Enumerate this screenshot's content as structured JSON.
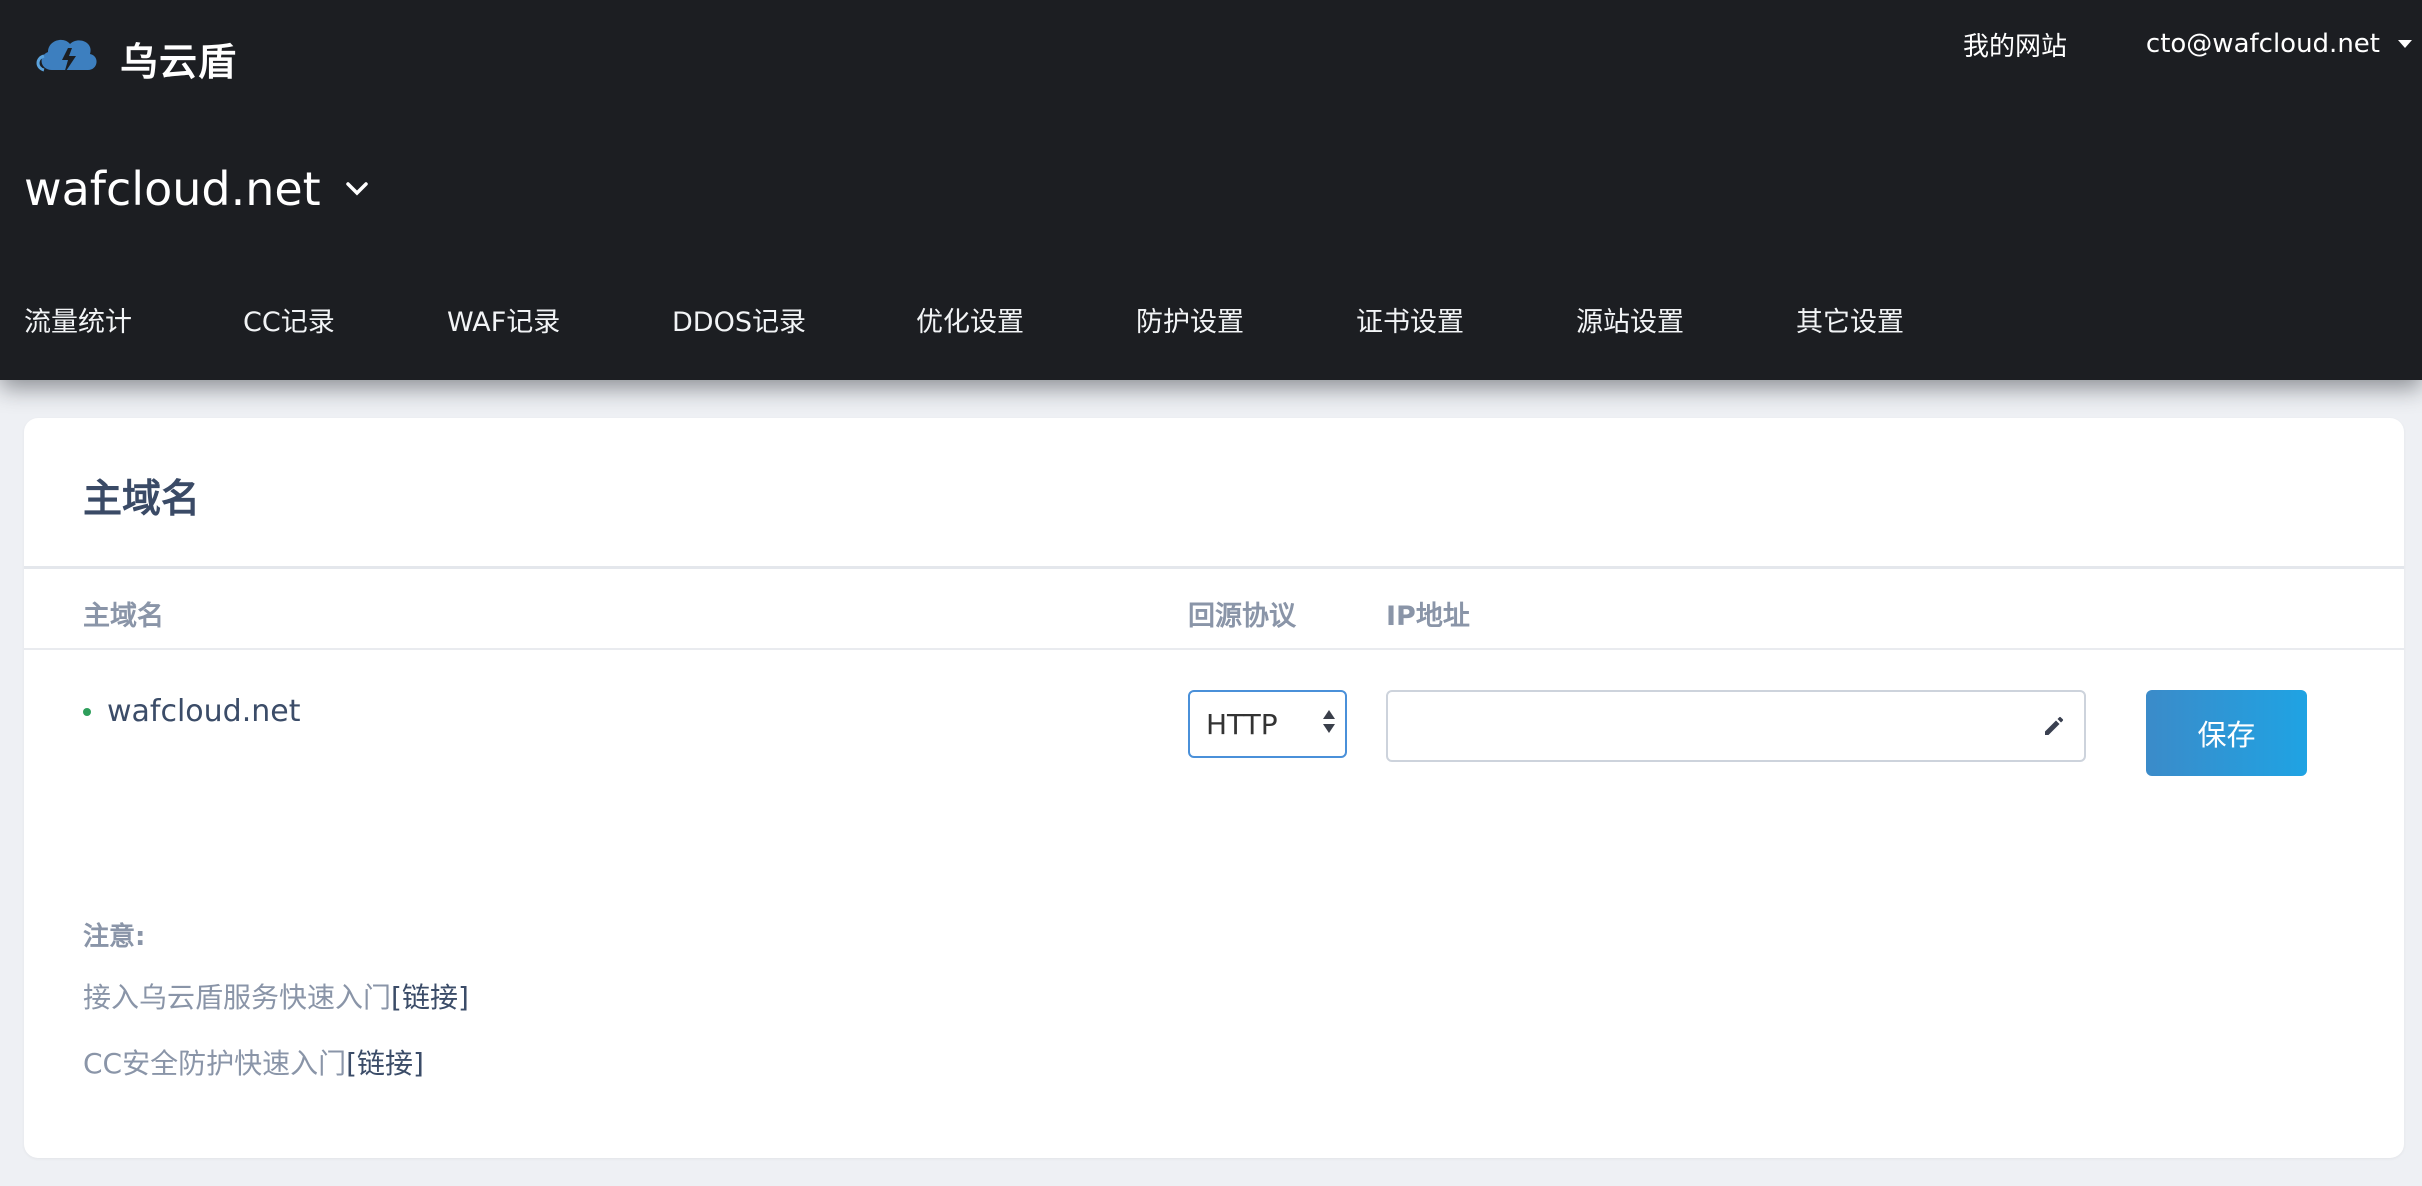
{
  "header": {
    "brand": "乌云盾",
    "my_sites": "我的网站",
    "account_email": "cto@wafcloud.net"
  },
  "site": {
    "name": "wafcloud.net"
  },
  "nav": {
    "items": [
      "流量统计",
      "CC记录",
      "WAF记录",
      "DDOS记录",
      "优化设置",
      "防护设置",
      "证书设置",
      "源站设置",
      "其它设置"
    ]
  },
  "card": {
    "title": "主域名",
    "columns": {
      "domain": "主域名",
      "protocol": "回源协议",
      "ip": "IP地址"
    },
    "row": {
      "domain": "wafcloud.net",
      "protocol": "HTTP",
      "ip_value": ""
    },
    "save_label": "保存",
    "notes": {
      "title": "注意:",
      "lines": [
        {
          "text": "接入乌云盾服务快速入门",
          "link": "[链接]"
        },
        {
          "text": "CC安全防护快速入门",
          "link": "[链接]"
        }
      ]
    }
  },
  "colors": {
    "topbar": "#1c1e22",
    "accent": "#1fa3e3",
    "status_dot": "#2e9e5b"
  },
  "icons": {
    "logo": "cloud-shield-icon",
    "edit": "pencil-icon"
  }
}
